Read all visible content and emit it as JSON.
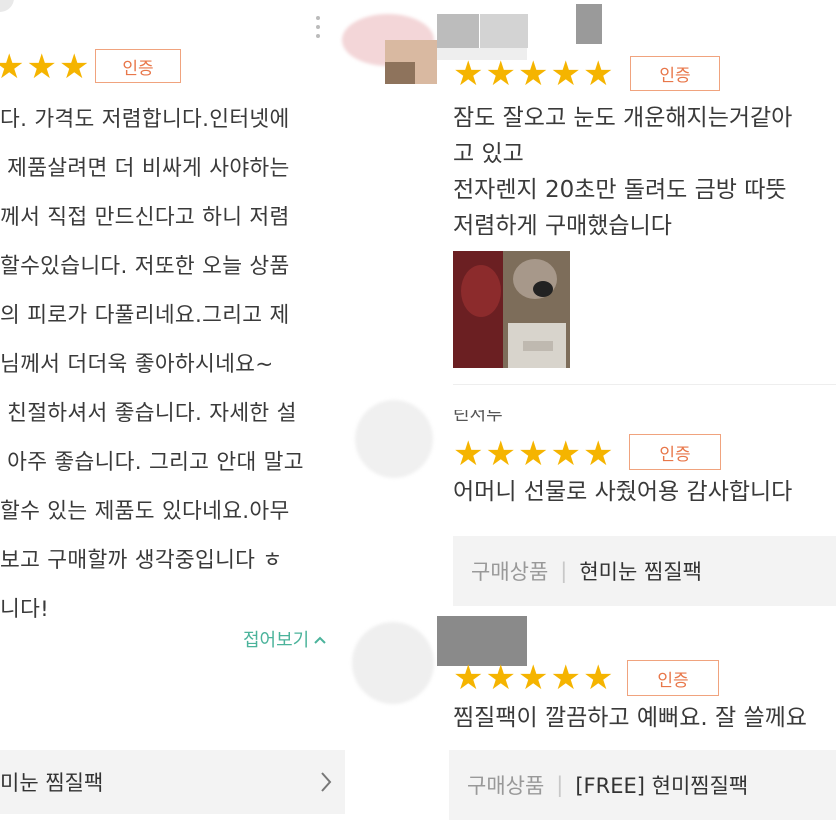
{
  "left_review": {
    "badge": "인증",
    "stars": [
      "★",
      "★",
      "★"
    ],
    "lines": [
      "다. 가격도 저렴합니다.인터넷에",
      " 제품살려면 더 비싸게 사야하는",
      "께서 직접 만드신다고 하니 저렴",
      "할수있습니다. 저또한 오늘 상품",
      "의 피로가 다풀리네요.그리고 제",
      "님께서 더더욱 좋아하시네요~",
      " 친절하셔서 좋습니다. 자세한 설",
      " 아주 좋습니다. 그리고 안대 말고",
      "할수 있는 제품도 있다네요.아무",
      "보고 구매할까 생각중입니다 ㅎ",
      "니다!"
    ],
    "collapse_label": "접어보기",
    "collapse_icon": "chevron-up-icon",
    "product_text": "미눈 찜질팩",
    "product_arrow": "chevron-right-icon"
  },
  "right_reviews": [
    {
      "badge": "인증",
      "stars": [
        "★",
        "★",
        "★",
        "★",
        "★"
      ],
      "lines": [
        "잠도 잘오고 눈도 개운해지는거같아",
        "고 있고",
        "전자렌지 20초만 돌려도 금방 따뜻",
        "저렴하게 구매했습니다"
      ],
      "has_photo": true
    },
    {
      "badge": "인증",
      "partial_name": "린서루",
      "stars": [
        "★",
        "★",
        "★",
        "★",
        "★"
      ],
      "lines": [
        "어머니 선물로 사줬어용 감사합니다"
      ],
      "product_label": "구매상품",
      "product_separator": "|",
      "product_name": "현미눈 찜질팩"
    },
    {
      "badge": "인증",
      "stars": [
        "★",
        "★",
        "★",
        "★",
        "★"
      ],
      "lines": [
        "찜질팩이 깔끔하고 예뻐요. 잘 쓸께요"
      ],
      "product_label": "구매상품",
      "product_separator": "|",
      "product_name": "[FREE] 현미찜질팩"
    }
  ],
  "colors": {
    "star": "#f5b400",
    "badge_border": "#f0a37e",
    "badge_text": "#e8774a",
    "collapse_green": "#4bb39b",
    "product_bar_bg": "#f3f3f3"
  }
}
